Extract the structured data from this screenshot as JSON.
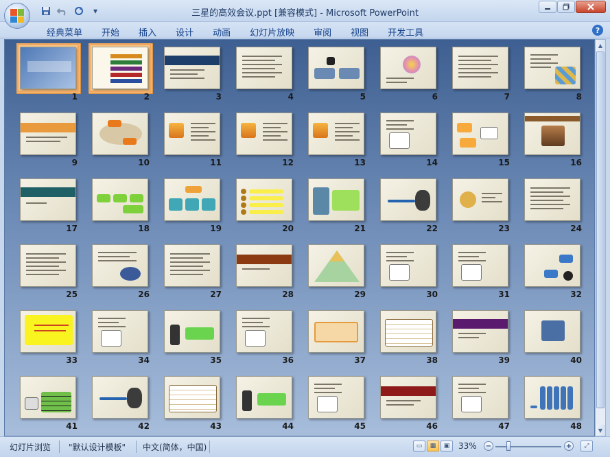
{
  "window": {
    "title": "三星的高效会议.ppt [兼容模式] - Microsoft PowerPoint",
    "minimize_icon": "minimize-icon",
    "maximize_icon": "restore-icon",
    "close_icon": "close-icon"
  },
  "qat": {
    "save_icon": "save-icon",
    "undo_icon": "undo-icon",
    "redo_icon": "redo-icon",
    "customize_icon": "dropdown-icon"
  },
  "ribbon": {
    "tabs": [
      "经典菜单",
      "开始",
      "插入",
      "设计",
      "动画",
      "幻灯片放映",
      "审阅",
      "视图",
      "开发工具"
    ],
    "help_label": "?"
  },
  "slides": [
    {
      "n": "1",
      "style": "title"
    },
    {
      "n": "2",
      "style": "menu"
    },
    {
      "n": "3",
      "style": "banner"
    },
    {
      "n": "4",
      "style": "text"
    },
    {
      "n": "5",
      "style": "diagram"
    },
    {
      "n": "6",
      "style": "flower"
    },
    {
      "n": "7",
      "style": "text"
    },
    {
      "n": "8",
      "style": "puzzle"
    },
    {
      "n": "9",
      "style": "orange-banner"
    },
    {
      "n": "10",
      "style": "oval"
    },
    {
      "n": "11",
      "style": "bigtext"
    },
    {
      "n": "12",
      "style": "bigtext"
    },
    {
      "n": "13",
      "style": "bigtext"
    },
    {
      "n": "14",
      "style": "people"
    },
    {
      "n": "15",
      "style": "orange-notes"
    },
    {
      "n": "16",
      "style": "photo"
    },
    {
      "n": "17",
      "style": "teal-banner"
    },
    {
      "n": "18",
      "style": "green-boxes"
    },
    {
      "n": "19",
      "style": "teal-cubes"
    },
    {
      "n": "20",
      "style": "yellow-list"
    },
    {
      "n": "21",
      "style": "green-panel"
    },
    {
      "n": "22",
      "style": "figure"
    },
    {
      "n": "23",
      "style": "clock"
    },
    {
      "n": "24",
      "style": "text"
    },
    {
      "n": "25",
      "style": "text"
    },
    {
      "n": "26",
      "style": "sketch"
    },
    {
      "n": "27",
      "style": "text"
    },
    {
      "n": "28",
      "style": "brown-banner"
    },
    {
      "n": "29",
      "style": "pyramid"
    },
    {
      "n": "30",
      "style": "people"
    },
    {
      "n": "31",
      "style": "people"
    },
    {
      "n": "32",
      "style": "blue-boxes"
    },
    {
      "n": "33",
      "style": "yellow-note"
    },
    {
      "n": "34",
      "style": "people"
    },
    {
      "n": "35",
      "style": "runner"
    },
    {
      "n": "36",
      "style": "people"
    },
    {
      "n": "37",
      "style": "orange-frame"
    },
    {
      "n": "38",
      "style": "table"
    },
    {
      "n": "39",
      "style": "purple-banner"
    },
    {
      "n": "40",
      "style": "device"
    },
    {
      "n": "41",
      "style": "green-table"
    },
    {
      "n": "42",
      "style": "figure"
    },
    {
      "n": "43",
      "style": "table"
    },
    {
      "n": "44",
      "style": "runner"
    },
    {
      "n": "45",
      "style": "people"
    },
    {
      "n": "46",
      "style": "red-banner"
    },
    {
      "n": "47",
      "style": "people"
    },
    {
      "n": "48",
      "style": "columns"
    }
  ],
  "status": {
    "view_label": "幻灯片浏览",
    "theme_label": "\"默认设计模板\"",
    "language_label": "中文(简体，中国)",
    "zoom_label": "33%",
    "zoom_out_label": "−",
    "zoom_in_label": "+"
  },
  "colors": {
    "accent_orange": "#e89a3c",
    "brown_banner": "#8b3a12",
    "teal_banner": "#1f5f66",
    "purple_banner": "#5a1a6e",
    "red_banner": "#8e1a1a"
  }
}
